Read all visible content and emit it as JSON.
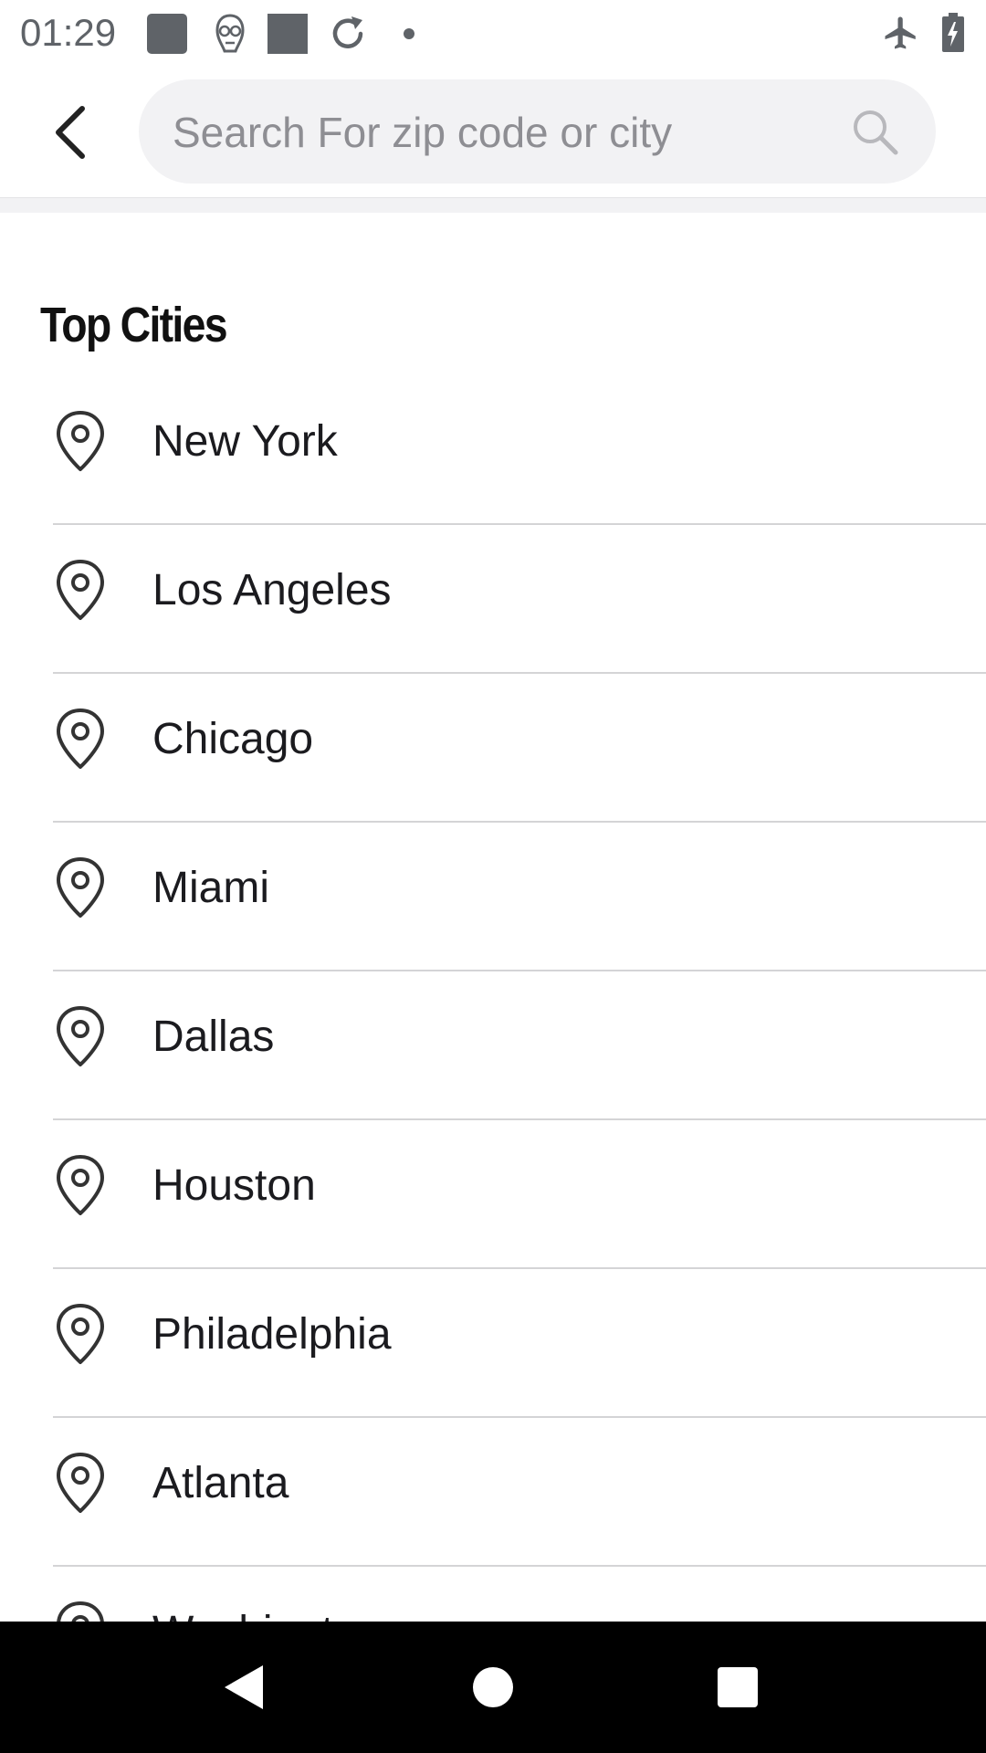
{
  "status_bar": {
    "time": "01:29",
    "icons": [
      "notification-square-icon",
      "alien-mask-icon",
      "notification-square-icon",
      "sync-icon",
      "dot-icon",
      "airplane-mode-icon",
      "battery-charging-icon"
    ]
  },
  "header": {
    "back_icon": "chevron-left-icon",
    "search": {
      "placeholder": "Search For zip code or city",
      "value": "",
      "icon": "search-icon"
    }
  },
  "content": {
    "section_title": "Top Cities",
    "cities": [
      {
        "label": "New York",
        "icon": "location-pin-icon"
      },
      {
        "label": "Los Angeles",
        "icon": "location-pin-icon"
      },
      {
        "label": "Chicago",
        "icon": "location-pin-icon"
      },
      {
        "label": "Miami",
        "icon": "location-pin-icon"
      },
      {
        "label": "Dallas",
        "icon": "location-pin-icon"
      },
      {
        "label": "Houston",
        "icon": "location-pin-icon"
      },
      {
        "label": "Philadelphia",
        "icon": "location-pin-icon"
      },
      {
        "label": "Atlanta",
        "icon": "location-pin-icon"
      },
      {
        "label": "Washington",
        "icon": "location-pin-icon"
      }
    ]
  },
  "nav_bar": {
    "icons": [
      "back-triangle-icon",
      "home-circle-icon",
      "recents-square-icon"
    ]
  }
}
